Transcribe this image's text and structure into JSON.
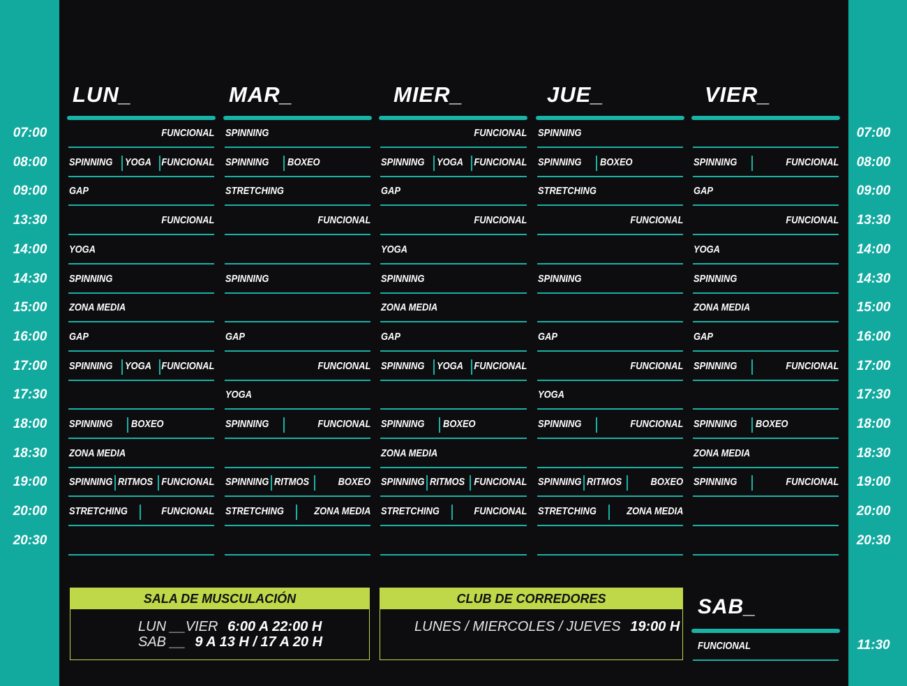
{
  "days": [
    "LUN_",
    "MAR_",
    "MIER_",
    "JUE_",
    "VIER_"
  ],
  "times": [
    "07:00",
    "08:00",
    "09:00",
    "13:30",
    "14:00",
    "14:30",
    "15:00",
    "16:00",
    "17:00",
    "17:30",
    "18:00",
    "18:30",
    "19:00",
    "20:00",
    "20:30"
  ],
  "schedule": [
    [
      [
        "FUNCIONAL"
      ],
      [
        "SPINNING",
        "YOGA",
        "FUNCIONAL"
      ],
      [
        "GAP"
      ],
      [
        "FUNCIONAL"
      ],
      [
        "YOGA"
      ],
      [
        "SPINNING"
      ],
      [
        "ZONA MEDIA"
      ],
      [
        "GAP"
      ],
      [
        "SPINNING",
        "YOGA",
        "FUNCIONAL"
      ],
      [],
      [
        "SPINNING",
        "BOXEO"
      ],
      [
        "ZONA MEDIA"
      ],
      [
        "SPINNING",
        "RITMOS",
        "FUNCIONAL"
      ],
      [
        "STRETCHING",
        "FUNCIONAL"
      ],
      []
    ],
    [
      [
        "SPINNING"
      ],
      [
        "SPINNING",
        "BOXEO"
      ],
      [
        "STRETCHING"
      ],
      [
        "FUNCIONAL"
      ],
      [],
      [
        "SPINNING"
      ],
      [],
      [
        "GAP"
      ],
      [
        "FUNCIONAL"
      ],
      [
        "YOGA"
      ],
      [
        "SPINNING",
        "FUNCIONAL"
      ],
      [],
      [
        "SPINNING",
        "RITMOS",
        "BOXEO"
      ],
      [
        "STRETCHING",
        "ZONA MEDIA"
      ],
      []
    ],
    [
      [
        "FUNCIONAL"
      ],
      [
        "SPINNING",
        "YOGA",
        "FUNCIONAL"
      ],
      [
        "GAP"
      ],
      [
        "FUNCIONAL"
      ],
      [
        "YOGA"
      ],
      [
        "SPINNING"
      ],
      [
        "ZONA MEDIA"
      ],
      [
        "GAP"
      ],
      [
        "SPINNING",
        "YOGA",
        "FUNCIONAL"
      ],
      [],
      [
        "SPINNING",
        "BOXEO"
      ],
      [
        "ZONA MEDIA"
      ],
      [
        "SPINNING",
        "RITMOS",
        "FUNCIONAL"
      ],
      [
        "STRETCHING",
        "FUNCIONAL"
      ],
      []
    ],
    [
      [
        "SPINNING"
      ],
      [
        "SPINNING",
        "BOXEO"
      ],
      [
        "STRETCHING"
      ],
      [
        "FUNCIONAL"
      ],
      [],
      [
        "SPINNING"
      ],
      [],
      [
        "GAP"
      ],
      [
        "FUNCIONAL"
      ],
      [
        "YOGA"
      ],
      [
        "SPINNING",
        "FUNCIONAL"
      ],
      [],
      [
        "SPINNING",
        "RITMOS",
        "BOXEO"
      ],
      [
        "STRETCHING",
        "ZONA MEDIA"
      ],
      []
    ],
    [
      [],
      [
        "SPINNING",
        "FUNCIONAL"
      ],
      [
        "GAP"
      ],
      [
        "FUNCIONAL"
      ],
      [
        "YOGA"
      ],
      [
        "SPINNING"
      ],
      [
        "ZONA MEDIA"
      ],
      [
        "GAP"
      ],
      [
        "SPINNING",
        "FUNCIONAL"
      ],
      [],
      [
        "SPINNING",
        "BOXEO"
      ],
      [
        "ZONA MEDIA"
      ],
      [
        "SPINNING",
        "FUNCIONAL"
      ],
      [],
      []
    ]
  ],
  "sala": {
    "title": "SALA DE MUSCULACIÓN",
    "line1_days": "LUN __VIER",
    "line1_hours": "6:00 A 22:00 H",
    "line2_days": "SAB __",
    "line2_hours": "9 A 13 H / 17 A 20 H"
  },
  "club": {
    "title": "CLUB DE CORREDORES",
    "days": "LUNES / MIERCOLES / JUEVES",
    "hour": "19:00 H"
  },
  "sab": {
    "title": "SAB_",
    "class": "FUNCIONAL",
    "time": "11:30"
  }
}
